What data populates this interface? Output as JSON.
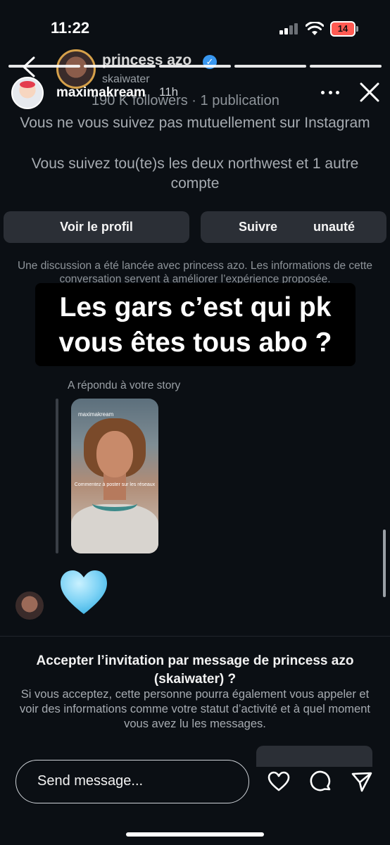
{
  "status_bar": {
    "time": "11:22",
    "battery": "14"
  },
  "story": {
    "username": "maximakream",
    "time_ago": "11h",
    "caption_line1": "Les gars c’est qui pk",
    "caption_line2": "vous êtes tous abo ?",
    "progress_segments": 5,
    "thumbnail_username": "maximakream",
    "thumbnail_text": "Commentez à poster sur les réseaux"
  },
  "dm": {
    "name": "princess azo",
    "handle": "skaiwater",
    "stats": "190 K followers · 1 publication",
    "mutual_info": "Vous ne vous suivez pas mutuellement sur Instagram",
    "follow_info": "Vous suivez tou(te)s les deux northwest et 1 autre compte",
    "view_profile_label": "Voir le profil",
    "follow_label": "Suivre",
    "follow_suffix": "unauté",
    "notice": "Une discussion a été lancée avec princess azo. Les informations de cette conversation servent à améliorer l’expérience proposée.",
    "replied_label": "A répondu à votre story",
    "accept_title": "Accepter l’invitation par message de princess azo (skaiwater) ?",
    "accept_body": "Si vous acceptez, cette personne pourra également vous appeler et voir des informations comme votre statut d’activité et à quel moment vous avez lu les messages."
  },
  "composer": {
    "placeholder": "Send message..."
  },
  "colors": {
    "background": "#0b0f14",
    "button": "#2b2f36",
    "verified": "#3897f0",
    "battery_low": "#ff5a52",
    "heart_emoji": "#7fd3f5"
  },
  "icons": [
    "back-icon",
    "verified-icon",
    "more-icon",
    "close-icon",
    "heart-icon",
    "comment-icon",
    "send-icon",
    "signal-icon",
    "wifi-icon",
    "battery-icon"
  ]
}
